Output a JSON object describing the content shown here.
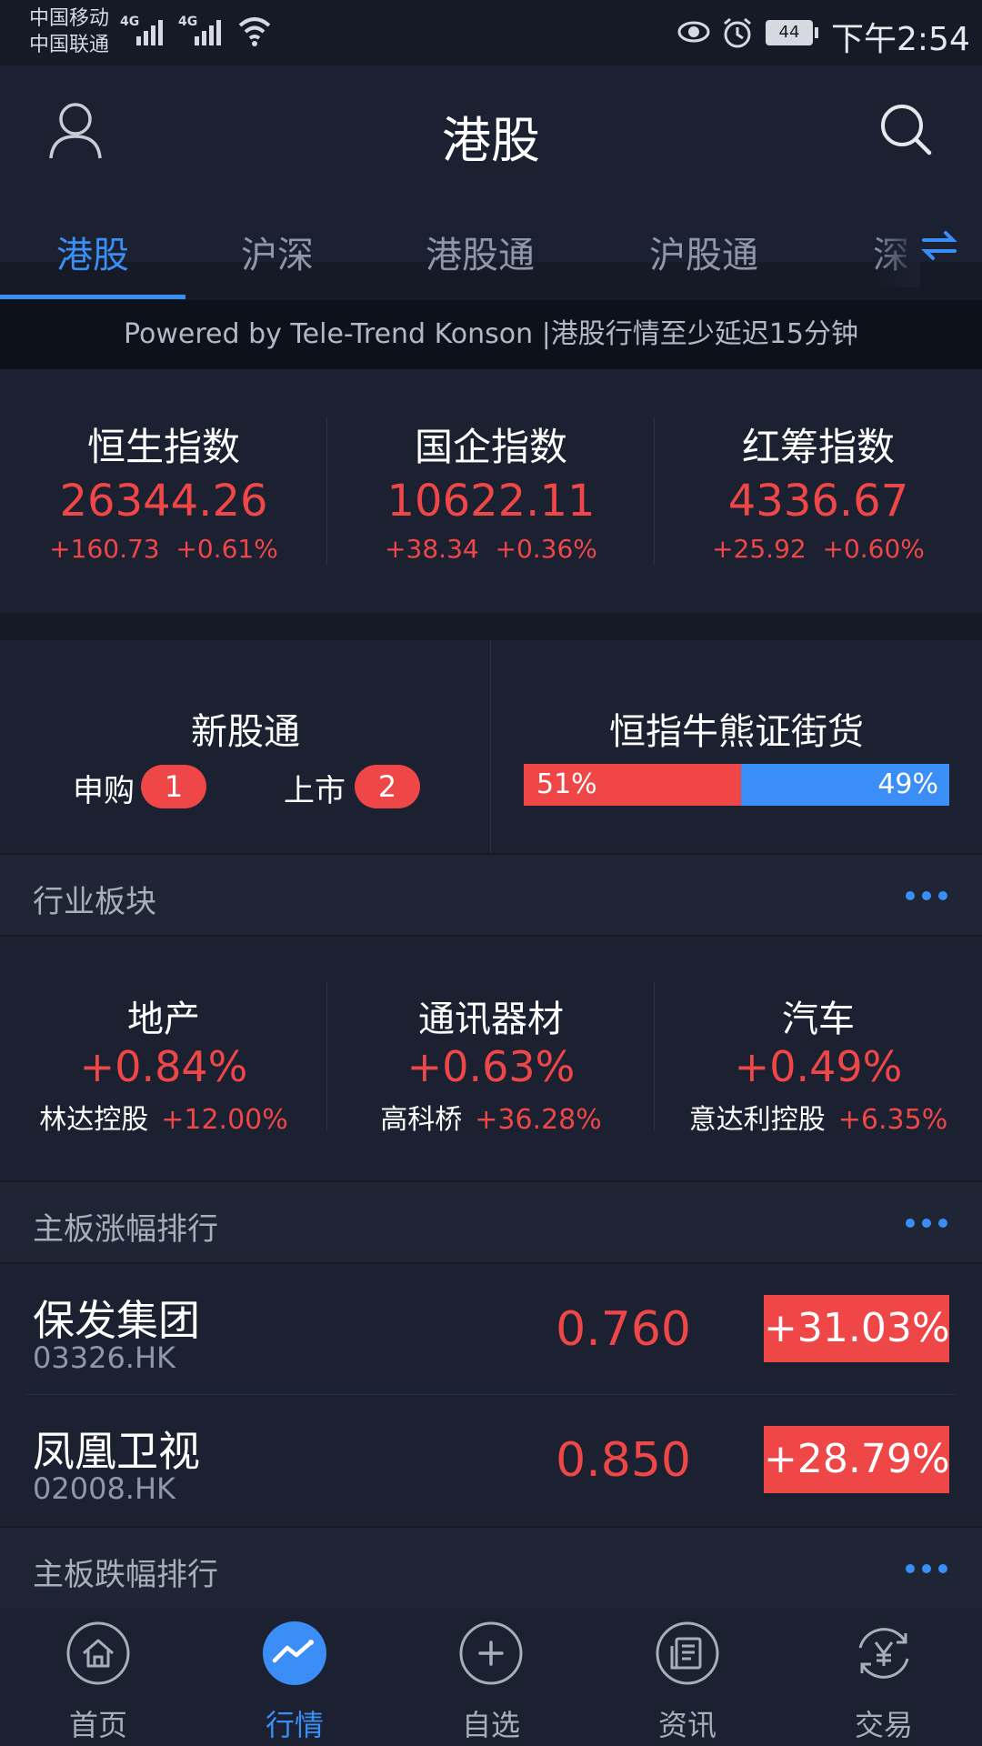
{
  "status_bar": {
    "carrier1": "中国移动",
    "carrier2": "中国联通",
    "net1": "4G",
    "net2": "4G",
    "battery": "44",
    "time": "下午2:54"
  },
  "header": {
    "title": "港股"
  },
  "tabs": [
    {
      "label": "港股",
      "active": true
    },
    {
      "label": "沪深"
    },
    {
      "label": "港股通"
    },
    {
      "label": "沪股通"
    },
    {
      "label": "深"
    }
  ],
  "banner": "Powered by Tele-Trend Konson |港股行情至少延迟15分钟",
  "indices": [
    {
      "name": "恒生指数",
      "value": "26344.26",
      "change": "+160.73  +0.61%"
    },
    {
      "name": "国企指数",
      "value": "10622.11",
      "change": "+38.34  +0.36%"
    },
    {
      "name": "红筹指数",
      "value": "4336.67",
      "change": "+25.92  +0.60%"
    }
  ],
  "ipo": {
    "title": "新股通",
    "subscribe_label": "申购",
    "subscribe_count": "1",
    "listing_label": "上市",
    "listing_count": "2"
  },
  "bull_bear": {
    "title": "恒指牛熊证街货",
    "bull_pct_label": "51%",
    "bear_pct_label": "49%",
    "bull_fraction": 0.51
  },
  "industry": {
    "title": "行业板块",
    "items": [
      {
        "name": "地产",
        "pct": "+0.84%",
        "top_stock": "林达控股",
        "top_pct": "+12.00%"
      },
      {
        "name": "通讯器材",
        "pct": "+0.63%",
        "top_stock": "高科桥",
        "top_pct": "+36.28%"
      },
      {
        "name": "汽车",
        "pct": "+0.49%",
        "top_stock": "意达利控股",
        "top_pct": "+6.35%"
      }
    ]
  },
  "gainers": {
    "title": "主板涨幅排行",
    "rows": [
      {
        "name": "保发集团",
        "code": "03326.HK",
        "price": "0.760",
        "change": "+31.03%"
      },
      {
        "name": "凤凰卫视",
        "code": "02008.HK",
        "price": "0.850",
        "change": "+28.79%"
      }
    ]
  },
  "losers": {
    "title": "主板跌幅排行"
  },
  "bottom_nav": [
    {
      "label": "首页",
      "icon": "home-icon"
    },
    {
      "label": "行情",
      "icon": "market-chart-icon",
      "active": true
    },
    {
      "label": "自选",
      "icon": "add-circle-icon"
    },
    {
      "label": "资讯",
      "icon": "news-icon"
    },
    {
      "label": "交易",
      "icon": "yen-trade-icon"
    }
  ],
  "colors": {
    "background": "#151a26",
    "panel": "#1b2130",
    "accent": "#3a8ef6",
    "up_red": "#ef4647"
  }
}
